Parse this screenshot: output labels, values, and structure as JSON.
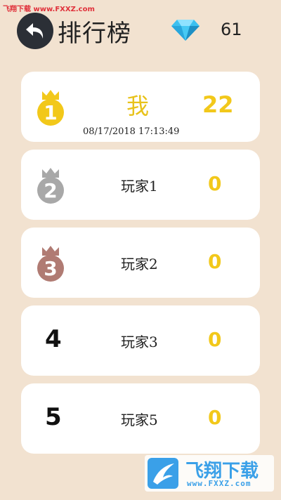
{
  "watermark": {
    "top_text": "飞翔下载 www.FXXZ.com",
    "logo_cn": "飞翔下载",
    "logo_url": "www.FXXZ.com"
  },
  "header": {
    "title": "排行榜",
    "gem_count": "61",
    "back_icon": "back-arrow-icon",
    "gem_icon": "diamond-icon"
  },
  "leaderboard": [
    {
      "rank": "1",
      "rank_icon": "crown-gold-1-icon",
      "name": "我",
      "score": "22",
      "timestamp": "08/17/2018 17:13:49"
    },
    {
      "rank": "2",
      "rank_icon": "crown-silver-2-icon",
      "name": "玩家1",
      "score": "0"
    },
    {
      "rank": "3",
      "rank_icon": "crown-bronze-3-icon",
      "name": "玩家2",
      "score": "0"
    },
    {
      "rank": "4",
      "name": "玩家3",
      "score": "0"
    },
    {
      "rank": "5",
      "name": "玩家5",
      "score": "0"
    }
  ],
  "colors": {
    "background": "#f2e2d0",
    "gold": "#f2c81a",
    "silver": "#a8a8a8",
    "bronze": "#b07b73",
    "gem": "#3cc0f0"
  }
}
